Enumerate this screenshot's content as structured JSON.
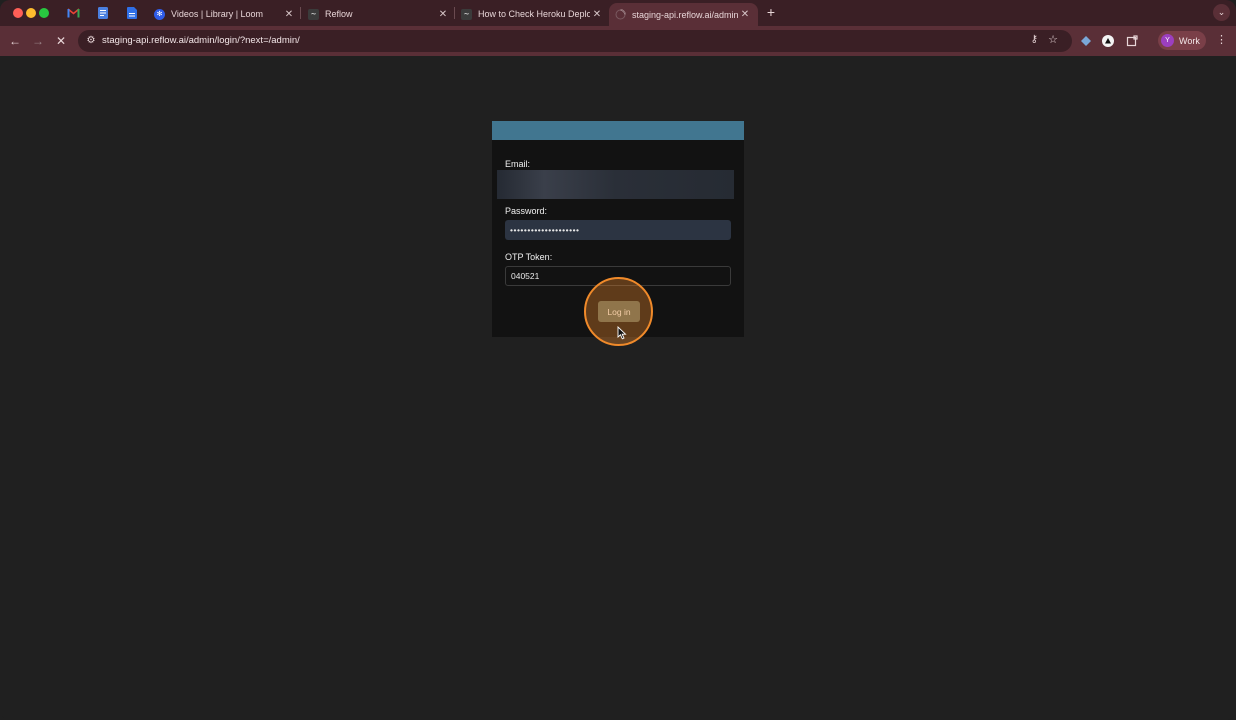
{
  "browser": {
    "tabs": [
      {
        "title": "",
        "favicon": "gmail-icon",
        "pinned": true
      },
      {
        "title": "",
        "favicon": "docs-icon",
        "pinned": true
      },
      {
        "title": "",
        "favicon": "doc-icon",
        "pinned": true
      },
      {
        "title": "Videos | Library | Loom",
        "favicon": "loom-icon"
      },
      {
        "title": "Reflow",
        "favicon": "reflow-icon"
      },
      {
        "title": "How to Check Heroku Deploy",
        "favicon": "reflow-icon"
      },
      {
        "title": "staging-api.reflow.ai/admin/lo",
        "favicon": "loading-spinner-icon",
        "active": true
      }
    ],
    "url": "staging-api.reflow.ai/admin/login/?next=/admin/",
    "profile": {
      "initial": "Y",
      "label": "Work"
    },
    "accent_color": "#5a2f37"
  },
  "login": {
    "header_color": "#417690",
    "email_label": "Email:",
    "email_value": "",
    "password_label": "Password:",
    "password_value": "••••••••••••••••••••",
    "otp_label": "OTP Token:",
    "otp_value": "040521",
    "submit_label": "Log in"
  }
}
